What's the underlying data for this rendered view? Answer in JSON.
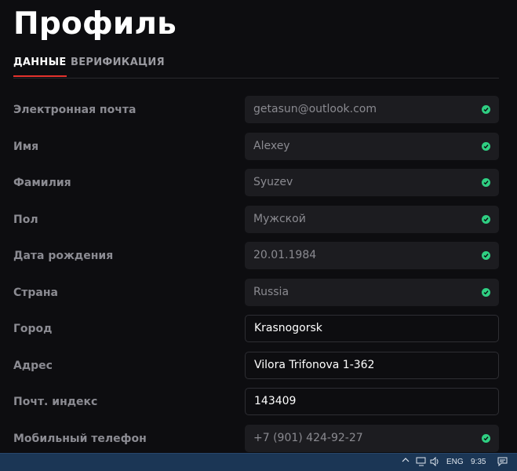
{
  "page": {
    "title": "Профиль"
  },
  "tabs": [
    {
      "label": "ДАННЫЕ",
      "active": true
    },
    {
      "label": "ВЕРИФИКАЦИЯ",
      "active": false
    }
  ],
  "fields": {
    "email": {
      "label": "Электронная почта",
      "value": "getasun@outlook.com",
      "verified": true
    },
    "first_name": {
      "label": "Имя",
      "value": "Alexey",
      "verified": true
    },
    "last_name": {
      "label": "Фамилия",
      "value": "Syuzev",
      "verified": true
    },
    "gender": {
      "label": "Пол",
      "value": "Мужской",
      "verified": true
    },
    "birth_date": {
      "label": "Дата рождения",
      "value": "20.01.1984",
      "verified": true
    },
    "country": {
      "label": "Страна",
      "value": "Russia",
      "verified": true
    },
    "city": {
      "label": "Город",
      "value": "Krasnogorsk",
      "verified": false
    },
    "address": {
      "label": "Адрес",
      "value": "Vilora Trifonova 1-362",
      "verified": false
    },
    "postal_code": {
      "label": "Почт. индекс",
      "value": "143409",
      "verified": false
    },
    "phone": {
      "label": "Мобильный телефон",
      "value": "+7 (901) 424-92-27",
      "verified": true
    }
  },
  "taskbar": {
    "language": "ENG",
    "time": "9:35",
    "icons": [
      "chevron-up-icon",
      "network-icon",
      "volume-icon",
      "notification-icon"
    ]
  },
  "colors": {
    "background": "#0d0d10",
    "field_readonly": "#1c1c20",
    "accent": "#e5322d",
    "verified": "#2fcf82",
    "taskbar": "#1b3655"
  }
}
